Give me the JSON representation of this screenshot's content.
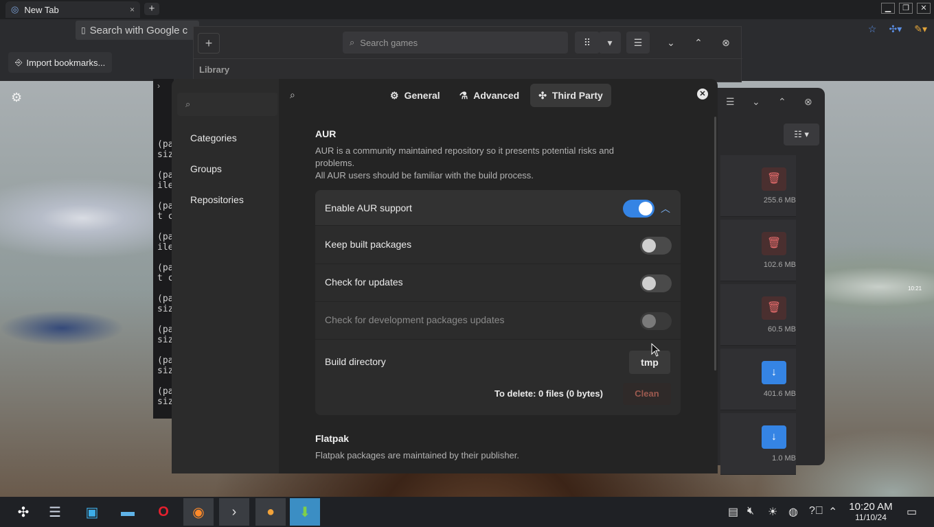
{
  "browser": {
    "tab_title": "New Tab",
    "tab_close": "×",
    "new_tab": "+",
    "omnibox_placeholder": "Search with Google c",
    "bookmark_button": "Import bookmarks...",
    "win_min": "▁",
    "win_max": "❐",
    "win_close": "✕"
  },
  "games": {
    "add": "+",
    "search_placeholder": "Search games",
    "grid": "⠿",
    "dropdown": "▾",
    "menu": "☰",
    "down": "⌄",
    "up": "⌃",
    "close": "⊗",
    "library_label": "Library"
  },
  "terminal": {
    "lines": [
      "(pa",
      "siz",
      "(pa",
      "ile",
      "(pa",
      "t c",
      "(pa",
      "ile",
      "(pa",
      "t c",
      "(pa",
      "siz",
      "(pa",
      "siz",
      "(pa",
      "siz",
      "(pa",
      "siz"
    ]
  },
  "dialog": {
    "side_items": [
      "Categories",
      "Groups",
      "Repositories"
    ],
    "tabs": [
      {
        "label": "General",
        "icon": "gear-icon",
        "glyph": "⚙"
      },
      {
        "label": "Advanced",
        "icon": "flask-icon",
        "glyph": "⚗"
      },
      {
        "label": "Third Party",
        "icon": "puzzle-icon",
        "glyph": "✣"
      }
    ],
    "active_tab": "Third Party",
    "aur": {
      "title": "AUR",
      "desc1": "AUR is a community maintained repository so it presents potential risks and",
      "desc2": "problems.",
      "desc3": "All AUR users should be familiar with the build process.",
      "enable_label": "Enable AUR support",
      "enable_on": true,
      "keep_label": "Keep built packages",
      "keep_on": false,
      "updates_label": "Check for updates",
      "updates_on": false,
      "dev_label": "Check for development packages updates",
      "dev_on": false,
      "build_dir_label": "Build directory",
      "build_dir_value": "tmp",
      "to_delete": "To delete:  0 files  (0 bytes)",
      "clean_label": "Clean"
    },
    "flatpak": {
      "title": "Flatpak",
      "desc": "Flatpak packages are maintained by their publisher."
    }
  },
  "right_panel": {
    "items": [
      {
        "size": "255.6 MB",
        "action": "delete"
      },
      {
        "size": "102.6 MB",
        "action": "delete"
      },
      {
        "size": "60.5 MB",
        "action": "delete"
      },
      {
        "size": "401.6 MB",
        "action": "download"
      },
      {
        "size": "1.0 MB",
        "action": "download"
      }
    ]
  },
  "taskbar": {
    "time": "10:20 AM",
    "date": "11/10/24"
  },
  "desktop": {
    "mini_clock": "10:21"
  },
  "colors": {
    "accent": "#3584e4",
    "danger": "#e46b6b"
  }
}
